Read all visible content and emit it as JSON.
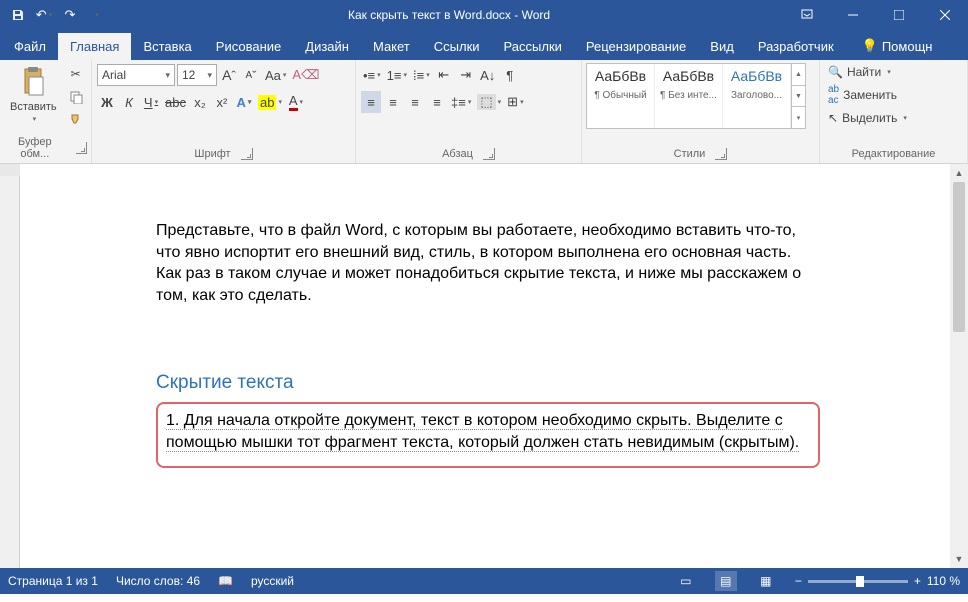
{
  "title": "Как скрыть текст в Word.docx - Word",
  "tabs": {
    "file": "Файл",
    "home": "Главная",
    "insert": "Вставка",
    "draw": "Рисование",
    "design": "Дизайн",
    "layout": "Макет",
    "references": "Ссылки",
    "mailings": "Рассылки",
    "review": "Рецензирование",
    "view": "Вид",
    "developer": "Разработчик",
    "tell_me": "Помощн"
  },
  "clipboard": {
    "paste": "Вставить",
    "group": "Буфер обм..."
  },
  "font": {
    "name": "Arial",
    "size": "12",
    "group": "Шрифт",
    "bold": "Ж",
    "italic": "К",
    "underline": "Ч",
    "strike": "abc",
    "sub": "x₂",
    "sup": "x²",
    "case": "Aa",
    "grow": "A",
    "shrink": "A"
  },
  "paragraph": {
    "group": "Абзац"
  },
  "styles": {
    "group": "Стили",
    "preview": "АаБбВв",
    "s1": "¶ Обычный",
    "s2": "¶ Без инте...",
    "s3": "Заголово..."
  },
  "editing": {
    "group": "Редактирование",
    "find": "Найти",
    "replace": "Заменить",
    "select": "Выделить"
  },
  "document": {
    "p1": "Представьте, что в файл Word, с которым вы работаете, необходимо вставить что-то, что явно испортит его внешний вид, стиль, в котором выполнена его основная часть. Как раз в таком случае и может понадобиться скрытие текста, и ниже мы расскажем о том, как это сделать.",
    "h1": "Скрытие текста",
    "p2": "1. Для начала откройте документ, текст в котором необходимо скрыть. Выделите с помощью мышки тот фрагмент текста, который должен стать невидимым (скрытым)."
  },
  "status": {
    "page": "Страница 1 из 1",
    "words": "Число слов: 46",
    "lang": "русский",
    "zoom": "110 %"
  }
}
